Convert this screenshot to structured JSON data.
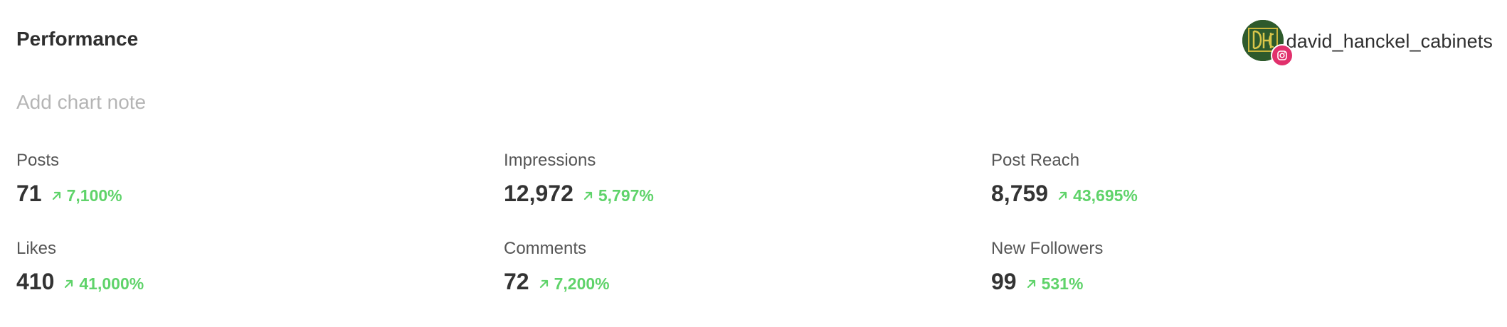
{
  "header": {
    "title": "Performance",
    "account_name": "david_hanckel_cabinets",
    "avatar_icon": "avatar-icon",
    "network_icon": "instagram-icon",
    "network_color": "#e1306c"
  },
  "note": {
    "placeholder": "Add chart note"
  },
  "colors": {
    "positive": "#5fd36a",
    "title": "#2f2f2f",
    "label": "#555555",
    "placeholder": "#b5b5b5"
  },
  "metrics": [
    {
      "label": "Posts",
      "value": "71",
      "change": "7,100%",
      "trend": "up"
    },
    {
      "label": "Impressions",
      "value": "12,972",
      "change": "5,797%",
      "trend": "up"
    },
    {
      "label": "Post Reach",
      "value": "8,759",
      "change": "43,695%",
      "trend": "up"
    },
    {
      "label": "Likes",
      "value": "410",
      "change": "41,000%",
      "trend": "up"
    },
    {
      "label": "Comments",
      "value": "72",
      "change": "7,200%",
      "trend": "up"
    },
    {
      "label": "New Followers",
      "value": "99",
      "change": "531%",
      "trend": "up"
    }
  ]
}
